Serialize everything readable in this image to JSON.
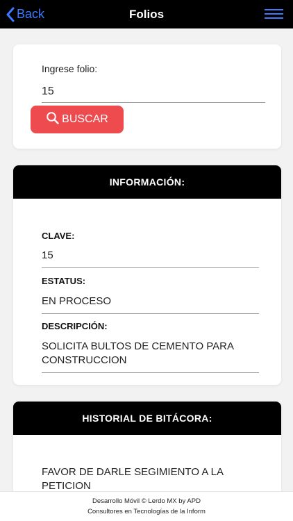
{
  "navbar": {
    "back_label": "Back",
    "title": "Folios",
    "accent_color": "#3a7bff",
    "back_icon": "chevron-left-icon",
    "menu_icon": "hamburger-menu-icon"
  },
  "search": {
    "label": "Ingrese folio:",
    "value": "15",
    "button_label": "BUSCAR",
    "button_icon": "search-icon",
    "button_color": "#ee4b4f"
  },
  "info": {
    "header": "INFORMACIÓN:",
    "fields": [
      {
        "label": "CLAVE:",
        "value": "15"
      },
      {
        "label": "ESTATUS:",
        "value": "EN PROCESO"
      },
      {
        "label": "DESCRIPCIÓN:",
        "value": "SOLICITA BULTOS DE CEMENTO PARA CONSTRUCCION"
      }
    ]
  },
  "history": {
    "header": "HISTORIAL DE BITÁCORA:",
    "entry": " FAVOR DE DARLE SEGIMIENTO A LA PETICION"
  },
  "footer": {
    "line1": "Desarrollo Móvil © Lerdo MX by APD",
    "line2": "Consultores en Tecnologías de la Inform"
  }
}
